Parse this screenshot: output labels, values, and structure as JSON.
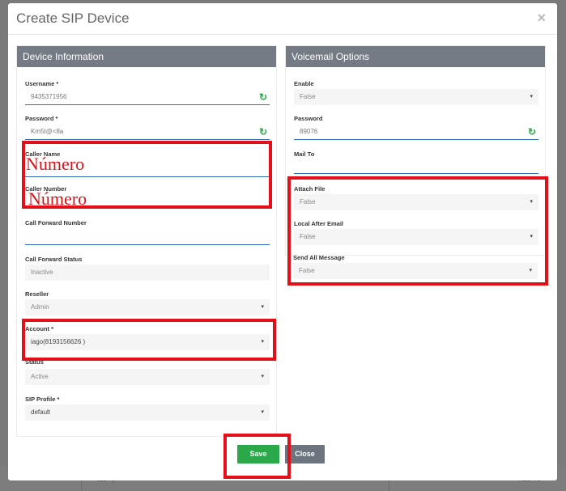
{
  "modal": {
    "title": "Create SIP Device",
    "close_glyph": "×"
  },
  "device_info": {
    "header": "Device Information",
    "username": {
      "label": "Username *",
      "value": "9435371956"
    },
    "password": {
      "label": "Password *",
      "value": "Km5I@<8a"
    },
    "caller_name": {
      "label": "Caller Name",
      "value": "Número"
    },
    "caller_number": {
      "label": "Caller Number",
      "value": "Número"
    },
    "call_forward_number": {
      "label": "Call Forward Number",
      "value": ""
    },
    "call_forward_status": {
      "label": "Call Forward Status",
      "value": "Inactive"
    },
    "reseller": {
      "label": "Reseller",
      "value": "Admin"
    },
    "account": {
      "label": "Account *",
      "value": "iago(8193156626 )"
    },
    "status": {
      "label": "Status",
      "value": "Active"
    },
    "sip_profile": {
      "label": "SIP Profile *",
      "value": "default"
    }
  },
  "voicemail": {
    "header": "Voicemail Options",
    "enable": {
      "label": "Enable",
      "value": "False"
    },
    "password": {
      "label": "Password",
      "value": "89076"
    },
    "mail_to": {
      "label": "Mail To",
      "value": ""
    },
    "attach_file": {
      "label": "Attach File",
      "value": "False"
    },
    "local_after_email": {
      "label": "Local After Email",
      "value": "False"
    },
    "send_all_message": {
      "label": "Send All Message",
      "value": "False"
    }
  },
  "buttons": {
    "save": "Save",
    "close": "Close"
  },
  "icons": {
    "refresh": "↻",
    "caret": "▾"
  },
  "background": {
    "cell_1": "68144)",
    "cell_2": "7520471"
  },
  "colors": {
    "accent_blue": "#2f6fb8",
    "save_green": "#2aa84a",
    "highlight_red": "#e3101a",
    "panel_header": "#747b84"
  }
}
